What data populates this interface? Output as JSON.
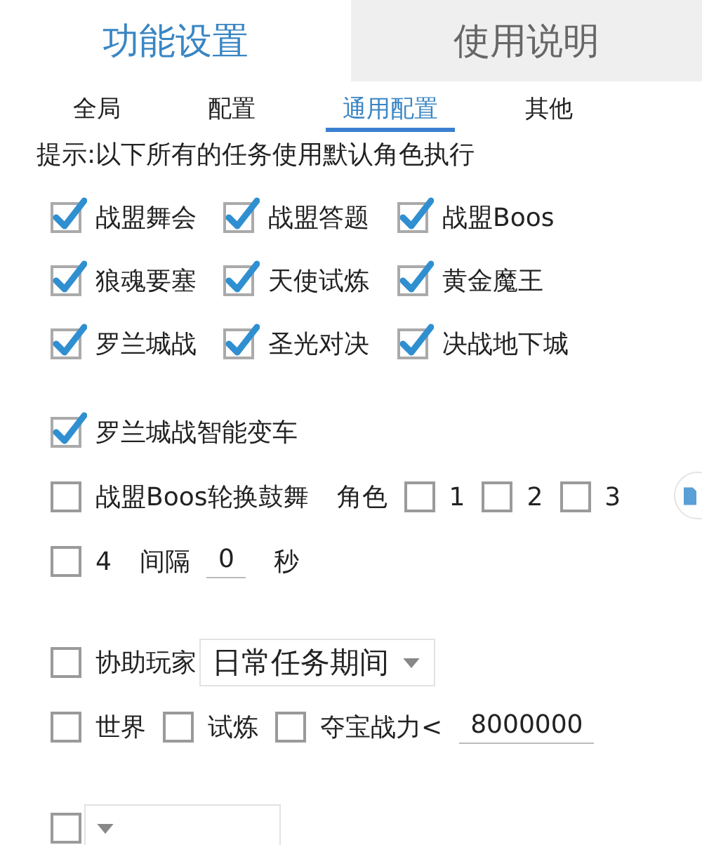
{
  "main_tabs": [
    {
      "label": "功能设置",
      "selected": true
    },
    {
      "label": "使用说明",
      "selected": false
    }
  ],
  "sub_tabs": [
    {
      "label": "全局",
      "selected": false
    },
    {
      "label": "配置",
      "selected": false
    },
    {
      "label": "通用配置",
      "selected": true
    },
    {
      "label": "其他",
      "selected": false
    }
  ],
  "hint": "提示:以下所有的任务使用默认角色执行",
  "task_checks": [
    {
      "label": "战盟舞会",
      "checked": true
    },
    {
      "label": "战盟答题",
      "checked": true
    },
    {
      "label": "战盟Boos",
      "checked": true
    },
    {
      "label": "狼魂要塞",
      "checked": true
    },
    {
      "label": "天使试炼",
      "checked": true
    },
    {
      "label": "黄金魔王",
      "checked": true
    },
    {
      "label": "罗兰城战",
      "checked": true
    },
    {
      "label": "圣光对决",
      "checked": true
    },
    {
      "label": "决战地下城",
      "checked": true
    }
  ],
  "sections": [
    {
      "rows": [
        {
          "items": [
            {
              "kind": "checkbox",
              "label": "罗兰城战智能变车",
              "checked": true
            }
          ]
        },
        {
          "items": [
            {
              "kind": "checkbox",
              "label": "战盟Boos轮换鼓舞",
              "checked": false
            },
            {
              "kind": "text",
              "label": "角色"
            },
            {
              "kind": "checkbox",
              "label": "1",
              "checked": false
            },
            {
              "kind": "checkbox",
              "label": "2",
              "checked": false
            },
            {
              "kind": "checkbox",
              "label": "3",
              "checked": false
            }
          ]
        },
        {
          "items": [
            {
              "kind": "checkbox",
              "label": "4",
              "checked": false
            },
            {
              "kind": "text",
              "label": "间隔"
            },
            {
              "kind": "field",
              "value": "0"
            },
            {
              "kind": "text",
              "label": "秒"
            }
          ]
        }
      ]
    },
    {
      "rows": [
        {
          "items": [
            {
              "kind": "checkbox",
              "label": "协助玩家",
              "checked": false
            },
            {
              "kind": "dropdown",
              "value": "日常任务期间"
            }
          ]
        },
        {
          "items": [
            {
              "kind": "checkbox",
              "label": "世界",
              "checked": false
            },
            {
              "kind": "checkbox",
              "label": "试炼",
              "checked": false
            },
            {
              "kind": "checkbox",
              "label": "夺宝战力<",
              "checked": false
            },
            {
              "kind": "field",
              "value": "8000000"
            }
          ]
        }
      ]
    },
    {
      "rows": [
        {
          "items": [
            {
              "kind": "checkbox",
              "checked": false
            },
            {
              "kind": "dropdown"
            }
          ]
        }
      ]
    }
  ]
}
